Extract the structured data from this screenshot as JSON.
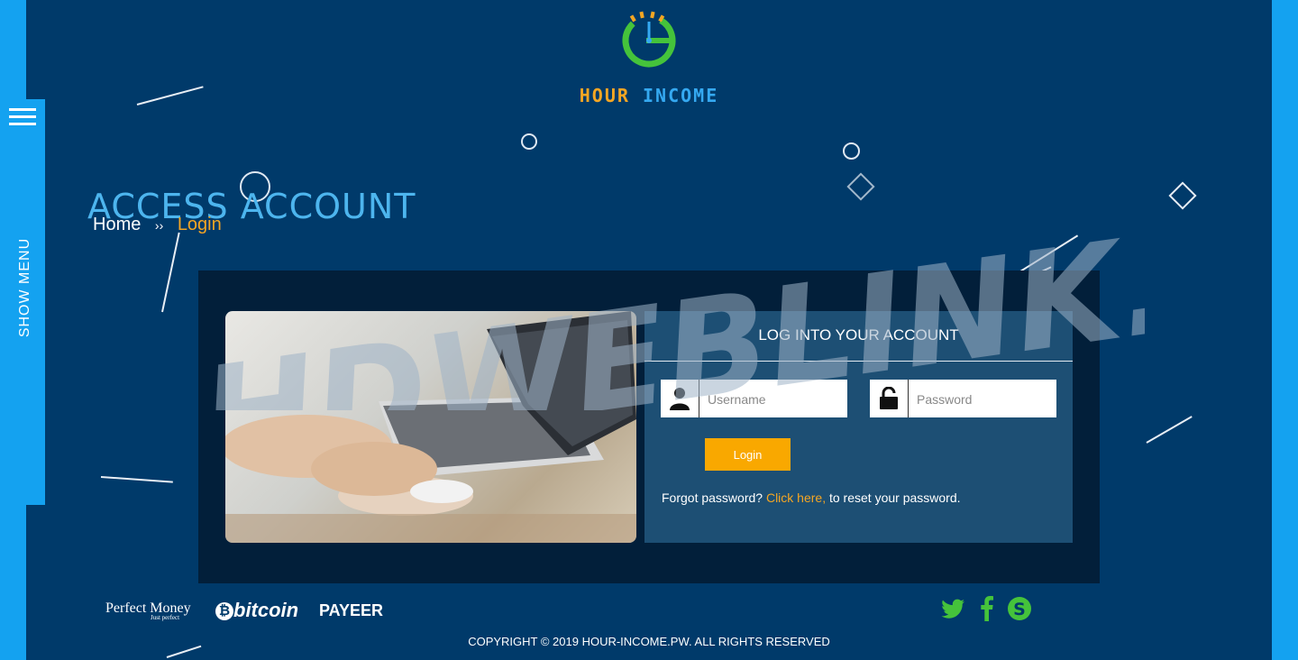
{
  "brand": {
    "name_part1": "HOUR",
    "name_part2": "INCOME",
    "logo_colors": {
      "green": "#45c33b",
      "orange": "#f5a623",
      "blue": "#35a9f1"
    }
  },
  "nav": {
    "show_menu_label": "SHOW MENU"
  },
  "page": {
    "title": "ACCESS ACCOUNT",
    "breadcrumb": {
      "home": "Home",
      "separator": "››",
      "current": "Login"
    }
  },
  "login": {
    "title": "LOG INTO YOUR ACCOUNT",
    "username_placeholder": "Username",
    "password_placeholder": "Password",
    "submit_label": "Login",
    "forgot_prefix": "Forgot password?",
    "forgot_link": "Click here,",
    "forgot_suffix": "to reset your password."
  },
  "payments": {
    "perfect_money": "Perfect Money",
    "perfect_money_tagline": "Just perfect",
    "bitcoin": "bitcoin",
    "payeer": "PAYEER"
  },
  "social": {
    "icons": [
      "twitter-icon",
      "facebook-icon",
      "skype-icon"
    ],
    "color": "#45c33b"
  },
  "footer": {
    "copyright": "COPYRIGHT © 2019 HOUR-INCOME.PW. ALL RIGHTS RESERVED"
  },
  "watermark": {
    "text": "HDWEBLINK.COM"
  },
  "colors": {
    "background": "#003a6a",
    "accent_blue": "#14a2f0",
    "accent_orange": "#f9a800",
    "panel": "#1d4f74"
  }
}
